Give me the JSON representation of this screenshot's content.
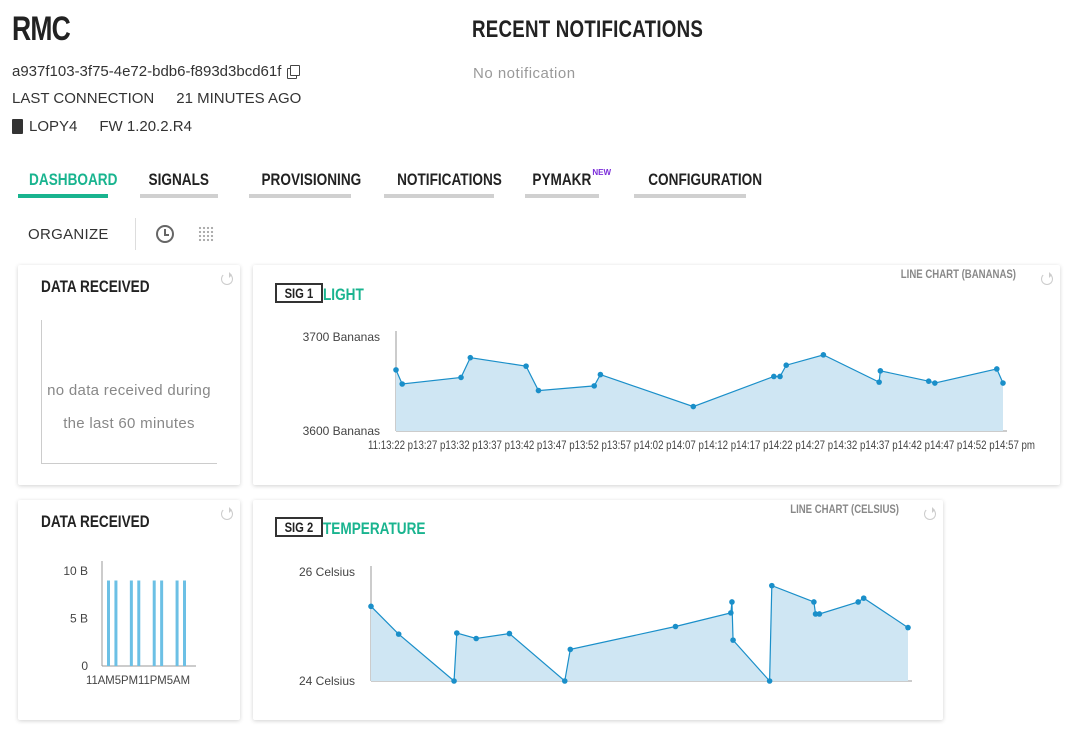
{
  "device": {
    "name": "RMC",
    "id": "a937f103-3f75-4e72-bdb6-f893d3bcd61f",
    "last_connection_label": "LAST CONNECTION",
    "last_connection_value": "21 MINUTES AGO",
    "board": "LOPY4",
    "firmware": "FW 1.20.2.R4"
  },
  "notifications": {
    "title": "RECENT NOTIFICATIONS",
    "empty_text": "No notification"
  },
  "tabs": [
    {
      "label": "DASHBOARD",
      "active": true
    },
    {
      "label": "SIGNALS",
      "active": false
    },
    {
      "label": "PROVISIONING",
      "active": false
    },
    {
      "label": "NOTIFICATIONS",
      "active": false
    },
    {
      "label": "PYMAKR",
      "active": false,
      "badge": "NEW"
    },
    {
      "label": "CONFIGURATION",
      "active": false
    }
  ],
  "toolbar": {
    "organize_label": "ORGANIZE",
    "icons": [
      "clock-icon",
      "grid-icon"
    ]
  },
  "colors": {
    "accent": "#19b48f",
    "line": "#1a8fc9",
    "area": "#cfe6f3",
    "badge_new": "#7a2bd9"
  },
  "cards": {
    "data_received_1": {
      "title": "DATA RECEIVED",
      "empty_text": "no data received during the last 60 minutes"
    },
    "light": {
      "badge": "SIG 1",
      "name": "LIGHT",
      "chart_type": "LINE CHART (BANANAS)"
    },
    "data_received_2": {
      "title": "DATA RECEIVED"
    },
    "temperature": {
      "badge": "SIG 2",
      "name": "TEMPERATURE",
      "chart_type": "LINE CHART (CELSIUS)"
    }
  },
  "chart_data": [
    {
      "type": "area",
      "ylabel_ticks": [
        "3700 Bananas",
        "3600 Bananas"
      ],
      "ylim": [
        3600,
        3700
      ],
      "x_tick_labels": [
        "11:13:22",
        "11:13:27",
        "11:13:32",
        "11:13:37",
        "11:13:42",
        "11:13:47",
        "11:13:52",
        "11:13:57",
        "11:14:02",
        "11:14:07",
        "11:14:12",
        "11:14:17",
        "11:14:22",
        "11:14:27",
        "11:14:32",
        "11:14:37",
        "11:14:42",
        "11:14:47",
        "11:14:52",
        "11:14:57 pm"
      ],
      "x_tick_display": "11:13:22 p13:27 p13:32 p13:37 p13:42 p13:47 p13:52 p13:57 p14:02 p14:07 p14:12 p14:17 p14:22 p14:27 p14:32 p14:37 p14:42 p14:47 p14:52 p14:57 pm",
      "series": [
        {
          "x": [
            0.0,
            1.0,
            10.5,
            12.0,
            21.0,
            23.0,
            32.0,
            33.0,
            48.0,
            61.0,
            62.0,
            63.0,
            69.0,
            78.0,
            78.2,
            86.0,
            87.0,
            97.0,
            98.0
          ],
          "values": [
            3665,
            3650,
            3657,
            3678,
            3669,
            3643,
            3648,
            3660,
            3626,
            3658,
            3658,
            3670,
            3681,
            3652,
            3664,
            3653,
            3651,
            3666,
            3651
          ]
        }
      ],
      "grid": false,
      "legend": "none"
    },
    {
      "type": "area",
      "ylabel_ticks": [
        "26 Celsius",
        "24 Celsius"
      ],
      "ylim": [
        24,
        26
      ],
      "series": [
        {
          "x": [
            0.0,
            5.0,
            15.0,
            15.5,
            19.0,
            25.0,
            35.0,
            36.0,
            55.0,
            65.0,
            65.2,
            65.4,
            72.0,
            72.4,
            80.0,
            80.3,
            81.0,
            88.0,
            89.0,
            97.0
          ],
          "values": [
            25.37,
            24.86,
            24.0,
            24.88,
            24.78,
            24.87,
            24.0,
            24.58,
            25.0,
            25.25,
            25.45,
            24.75,
            24.0,
            25.75,
            25.45,
            25.23,
            25.23,
            25.45,
            25.52,
            24.98
          ]
        }
      ],
      "grid": false,
      "legend": "none"
    },
    {
      "type": "bar",
      "ylabel_ticks": [
        "10 B",
        "5 B",
        "0"
      ],
      "ylim": [
        0,
        10
      ],
      "x_tick_display": "11AM5PM11PM5AM",
      "values": [
        9,
        9,
        9,
        9,
        9,
        9,
        9,
        9
      ],
      "grid": false,
      "legend": "none"
    }
  ]
}
